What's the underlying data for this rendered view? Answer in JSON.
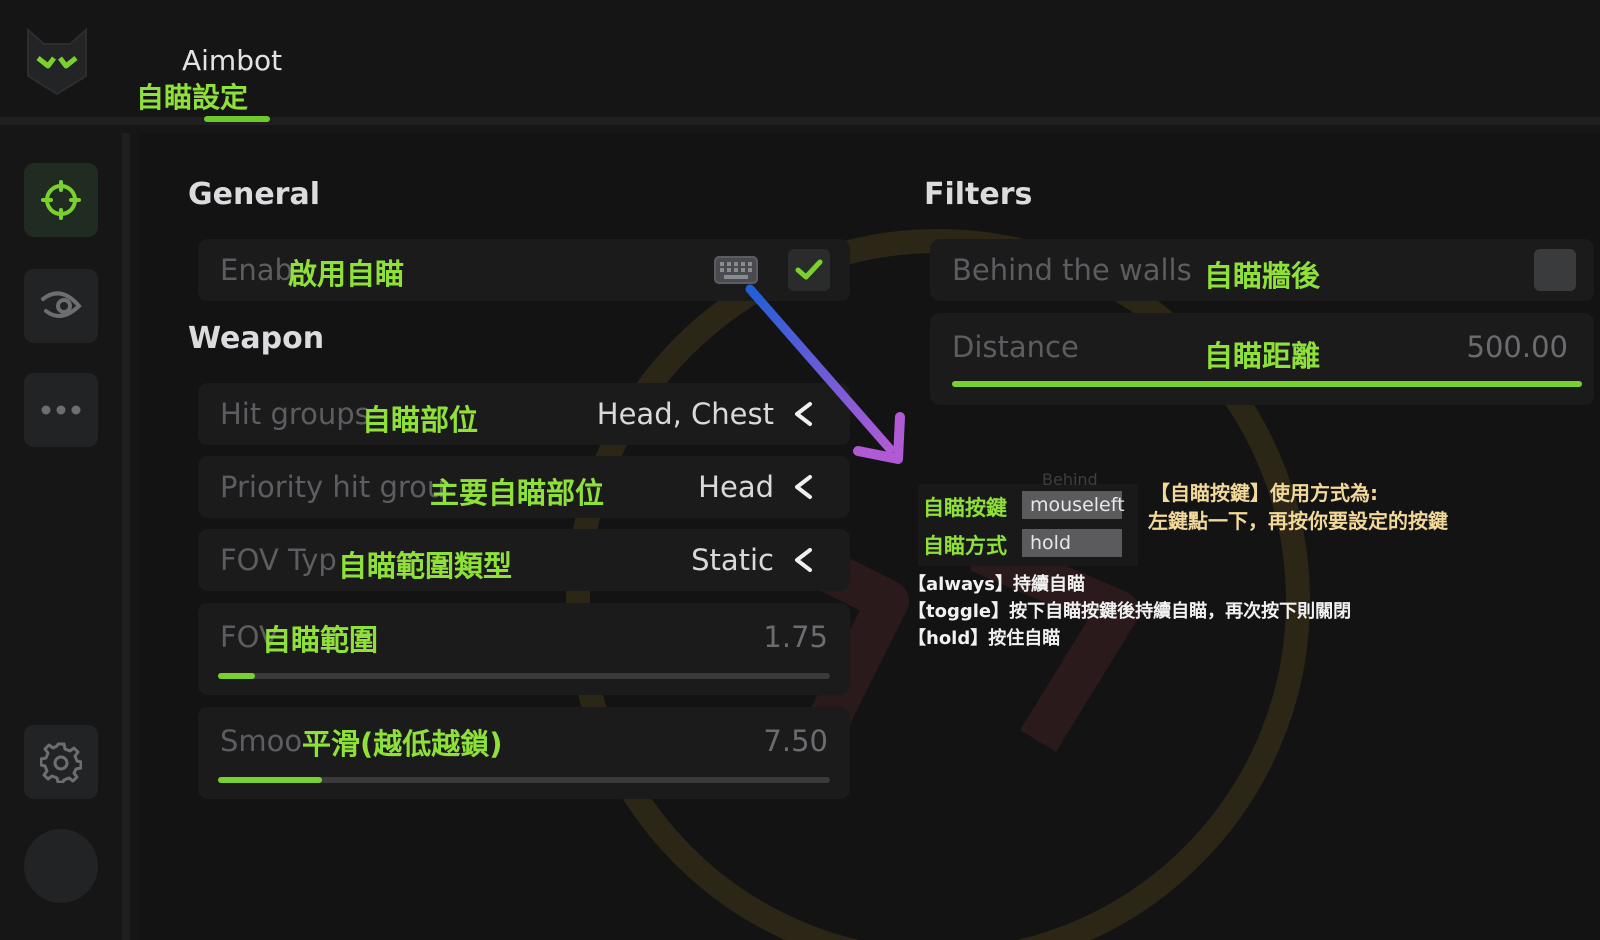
{
  "header": {
    "app_title": "Aimbot",
    "title_annotation": "自瞄設定"
  },
  "sidebar": {
    "items": [
      {
        "name": "aimbot",
        "icon": "crosshair-icon",
        "active": true
      },
      {
        "name": "visuals",
        "icon": "eye-icon",
        "active": false
      },
      {
        "name": "misc",
        "icon": "more-dots-icon",
        "active": false
      },
      {
        "name": "settings",
        "icon": "gear-icon",
        "active": false
      },
      {
        "name": "profile",
        "icon": "avatar",
        "active": false
      }
    ]
  },
  "general": {
    "title": "General",
    "enable": {
      "label": "Enab",
      "annotation": "啟用自瞄",
      "checked": true
    }
  },
  "weapon": {
    "title": "Weapon",
    "hit_groups": {
      "label": "Hit groups",
      "annotation": "自瞄部位",
      "value": "Head, Chest"
    },
    "priority_hit_group": {
      "label": "Priority hit grou",
      "annotation": "主要自瞄部位",
      "value": "Head"
    },
    "fov_type": {
      "label": "FOV Typ",
      "annotation": "自瞄範圍類型",
      "value": "Static"
    },
    "fov": {
      "label": "FOV",
      "annotation": "自瞄範圍",
      "value": "1.75",
      "fill": 0.06
    },
    "smooth": {
      "label": "Smoo",
      "annotation": "平滑(越低越鎖)",
      "value": "7.50",
      "fill": 0.17
    }
  },
  "filters": {
    "title": "Filters",
    "behind_walls": {
      "label": "Behind the walls",
      "annotation": "自瞄牆後",
      "checked": false
    },
    "distance": {
      "label": "Distance",
      "annotation": "自瞄距離",
      "value": "500.00",
      "fill": 1.0
    }
  },
  "keybind_popup": {
    "key_label": "自瞄按鍵",
    "key_value": "mouseleft",
    "mode_label": "自瞄方式",
    "mode_value": "hold",
    "partial_text": "Behind"
  },
  "notes": {
    "line1": "【自瞄按鍵】使用方式為:",
    "line2": "左鍵點一下，再按你要設定的按鍵",
    "always": "【always】持續自瞄",
    "toggle": "【toggle】按下自瞄按鍵後持續自瞄，再次按下則關閉",
    "hold": "【hold】按住自瞄"
  },
  "colors": {
    "accent": "#7ad12e",
    "annotation": "#8fe13a",
    "arrow_start": "#1f5fd8",
    "arrow_end": "#b15ad6"
  }
}
